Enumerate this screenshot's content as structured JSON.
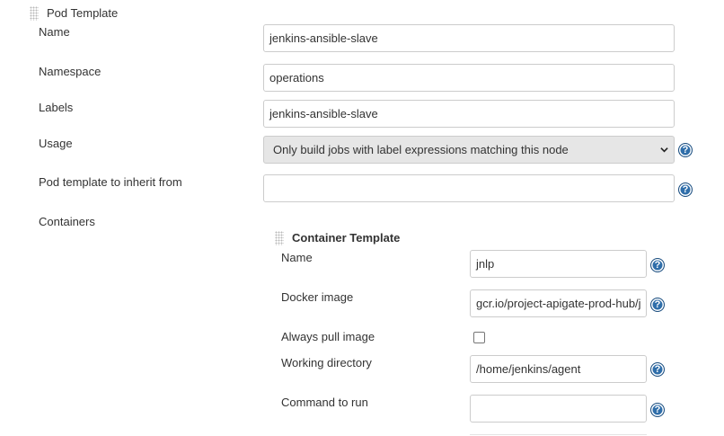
{
  "pod_template": {
    "section_title": "Pod Template",
    "fields": {
      "name": {
        "label": "Name",
        "value": "jenkins-ansible-slave"
      },
      "namespace": {
        "label": "Namespace",
        "value": "operations"
      },
      "labels": {
        "label": "Labels",
        "value": "jenkins-ansible-slave"
      },
      "usage": {
        "label": "Usage",
        "selected": "Only build jobs with label expressions matching this node"
      },
      "inherit_from": {
        "label": "Pod template to inherit from",
        "value": ""
      },
      "containers": {
        "label": "Containers"
      }
    }
  },
  "container_template": {
    "section_title": "Container Template",
    "fields": {
      "name": {
        "label": "Name",
        "value": "jnlp"
      },
      "docker_image": {
        "label": "Docker image",
        "value": "gcr.io/project-apigate-prod-hub/j"
      },
      "always_pull": {
        "label": "Always pull image",
        "checked": false
      },
      "working_directory": {
        "label": "Working directory",
        "value": "/home/jenkins/agent"
      },
      "command": {
        "label": "Command to run",
        "value": ""
      }
    }
  },
  "help_glyph": "?",
  "icons": [
    "drag-handle-icon",
    "chevron-down-icon",
    "help-icon"
  ],
  "colors": {
    "help_icon": "#2f6eaa",
    "select_background": "#e6e6e6",
    "input_border": "#cccccc"
  }
}
